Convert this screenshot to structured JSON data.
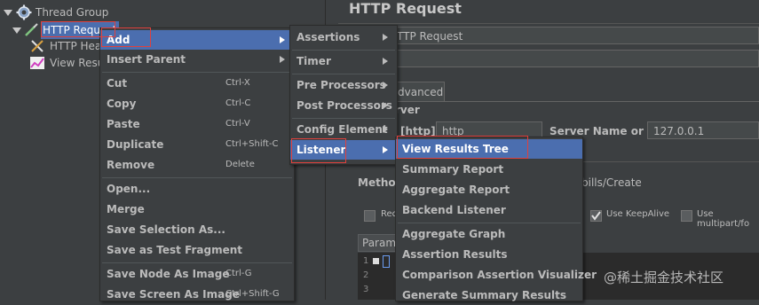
{
  "tree": {
    "thread_group": "Thread Group",
    "http_request": "HTTP Request",
    "http_header": "HTTP Hea",
    "view_results": "View Resu"
  },
  "right": {
    "title": "HTTP Request",
    "name_value": "HTTP Request",
    "comments_label": "s:",
    "tab_advanced": "dvanced",
    "server_group": "rver",
    "protocol_label": "[http]:",
    "protocol_value": "http",
    "server_label": "Server Name or IP:",
    "server_value": "127.0.0.1",
    "method_label": "Method",
    "path_value": "bills/Create",
    "redirect_label": "Red",
    "keepalive_label": "Use KeepAlive",
    "multipart_label": "Use multipart/fo",
    "params_label": "Parame",
    "line_numbers": [
      "1",
      "2",
      "3"
    ]
  },
  "menu1": {
    "items": [
      {
        "label": "Add"
      },
      {
        "label": "Insert Parent"
      },
      {
        "label": "Cut",
        "shortcut": "Ctrl-X"
      },
      {
        "label": "Copy",
        "shortcut": "Ctrl-C"
      },
      {
        "label": "Paste",
        "shortcut": "Ctrl-V"
      },
      {
        "label": "Duplicate",
        "shortcut": "Ctrl+Shift-C"
      },
      {
        "label": "Remove",
        "shortcut": "Delete"
      },
      {
        "label": "Open..."
      },
      {
        "label": "Merge"
      },
      {
        "label": "Save Selection As..."
      },
      {
        "label": "Save as Test Fragment"
      },
      {
        "label": "Save Node As Image",
        "shortcut": "Ctrl-G"
      },
      {
        "label": "Save Screen As Image",
        "shortcut": "Ctrl+Shift-G"
      }
    ]
  },
  "menu2": {
    "items": [
      {
        "label": "Assertions"
      },
      {
        "label": "Timer"
      },
      {
        "label": "Pre Processors"
      },
      {
        "label": "Post Processors"
      },
      {
        "label": "Config Element"
      },
      {
        "label": "Listener"
      }
    ]
  },
  "menu3": {
    "items": [
      {
        "label": "View Results Tree"
      },
      {
        "label": "Summary Report"
      },
      {
        "label": "Aggregate Report"
      },
      {
        "label": "Backend Listener"
      },
      {
        "label": "Aggregate Graph"
      },
      {
        "label": "Assertion Results"
      },
      {
        "label": "Comparison Assertion Visualizer"
      },
      {
        "label": "Generate Summary Results"
      }
    ]
  },
  "watermark": "@稀土掘金技术社区",
  "colors": {
    "selection": "#4b6eaf",
    "highlight_box": "#e0403c",
    "background": "#3c3f41"
  }
}
